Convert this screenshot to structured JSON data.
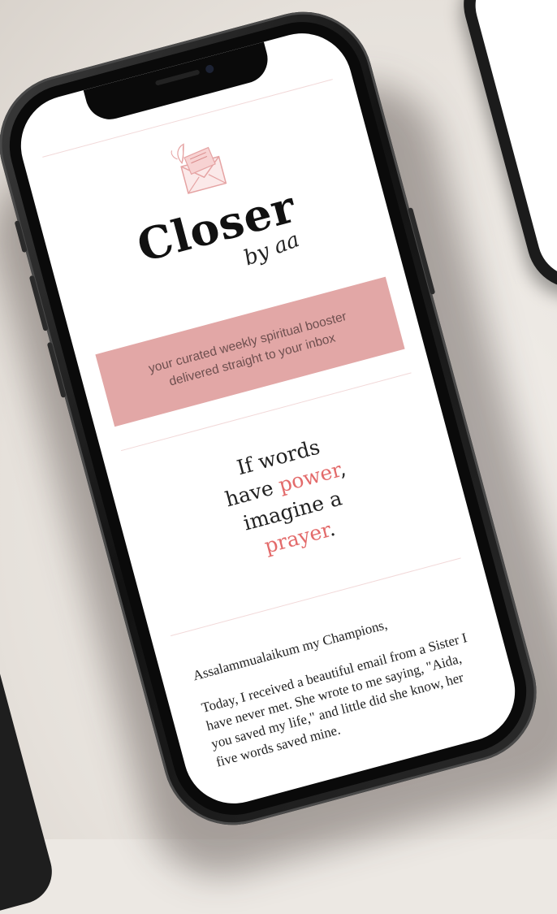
{
  "newsletter": {
    "logo_text": "Closer",
    "logo_byline": "by aa",
    "tagline_line1": "your curated weekly spiritual booster",
    "tagline_line2": "delivered straight to your inbox",
    "quote": {
      "line1": "If words",
      "line2_pre": "have ",
      "line2_accent": "power",
      "line2_post": ",",
      "line3": "imagine a",
      "line4_accent": "prayer",
      "line4_post": "."
    },
    "greeting": "Assalammualaikum my Champions,",
    "body": "Today, I received a beautiful email from a Sister I have never met. She wrote to me saying, \"Aida, you saved my life,\" and little did she know, her five words saved mine."
  },
  "colors": {
    "accent": "#e36b6b",
    "banner": "#e2a7a6",
    "divider": "#f2d9d9"
  },
  "icons": [
    "envelope-leaf-icon"
  ]
}
